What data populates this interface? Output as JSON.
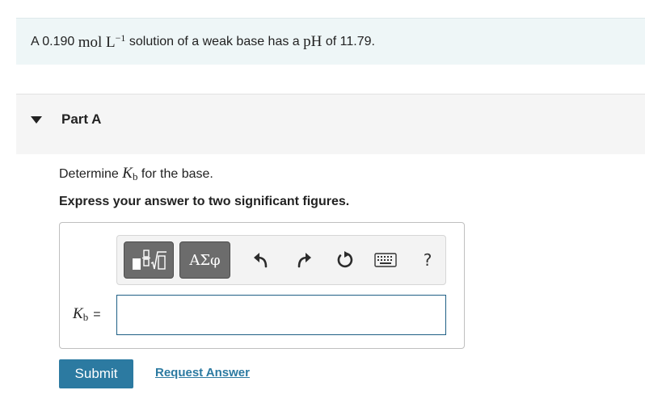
{
  "problem": {
    "prefix": "A 0.190",
    "unit": "mol L",
    "unit_exp": "−1",
    "middle": "solution of a weak base has a",
    "ph_label": "pH",
    "suffix": "of 11.79."
  },
  "part": {
    "title": "Part A"
  },
  "question": {
    "determine": "Determine",
    "k": "K",
    "k_sub": "b",
    "for_base": "for the base.",
    "instruction": "Express your answer to two significant figures."
  },
  "toolbar": {
    "greek_label": "ΑΣφ",
    "help_label": "?"
  },
  "answer": {
    "label_k": "K",
    "label_sub": "b",
    "equals": "=",
    "value": ""
  },
  "buttons": {
    "submit": "Submit",
    "request": "Request Answer"
  },
  "colors": {
    "accent": "#2c7aa1",
    "intro_bg": "#eef6f7",
    "part_header_bg": "#f5f5f5"
  },
  "icons": [
    "templates-icon",
    "undo-icon",
    "redo-icon",
    "reset-icon",
    "keyboard-icon",
    "help-icon"
  ]
}
